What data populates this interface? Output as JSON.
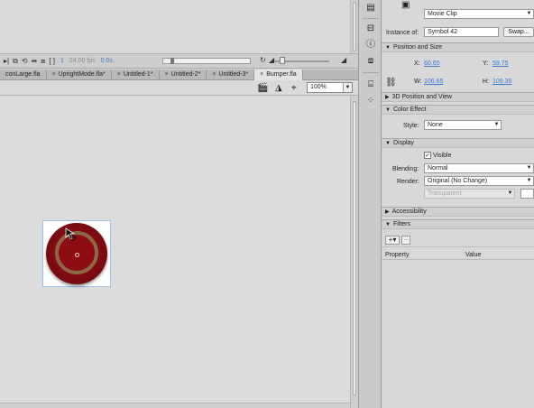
{
  "timeline": {
    "frame": "1",
    "fps": "24.00 fps",
    "time": "0.0s"
  },
  "tabs": [
    {
      "label": "conLarge.fla"
    },
    {
      "label": "UprightMode.fla*"
    },
    {
      "label": "Untitled-1*"
    },
    {
      "label": "Untitled-2*"
    },
    {
      "label": "Untitled-3*"
    },
    {
      "label": "Bumper.fla"
    }
  ],
  "stage_zoom": "100%",
  "panel": {
    "symbol_type": "Movie Clip",
    "instance_of_label": "Instance of:",
    "instance_of_value": "Symbol 42",
    "swap_button": "Swap...",
    "position_size": {
      "title": "Position and Size",
      "x_label": "X:",
      "x_value": "60.65",
      "y_label": "Y:",
      "y_value": "59.75",
      "w_label": "W:",
      "w_value": "106.65",
      "h_label": "H:",
      "h_value": "109.35"
    },
    "position_3d_title": "3D Position and View",
    "color_effect": {
      "title": "Color Effect",
      "style_label": "Style:",
      "style_value": "None"
    },
    "display": {
      "title": "Display",
      "visible_label": "Visible",
      "blending_label": "Blending:",
      "blending_value": "Normal",
      "render_label": "Render:",
      "render_value": "Original (No Change)",
      "transparent_value": "Transparent"
    },
    "accessibility_title": "Accessibility",
    "filters": {
      "title": "Filters",
      "col_property": "Property",
      "col_value": "Value"
    }
  },
  "colors": {
    "accent_link": "#3b7bd4",
    "symbol_red": "#8e0d14",
    "selection_border": "#9fc3ea"
  }
}
